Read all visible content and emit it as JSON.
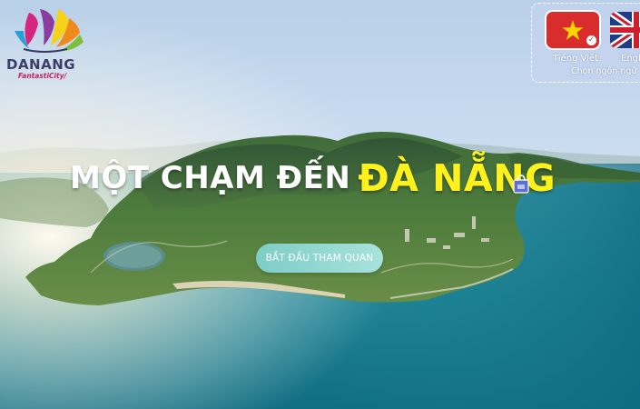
{
  "brand": {
    "name": "DANANG",
    "tagline": "FantastiCity/"
  },
  "languages": {
    "options": [
      {
        "label": "Tiếng Việt",
        "code": "vi",
        "selected": true
      },
      {
        "label": "English",
        "code": "en",
        "selected": false
      }
    ],
    "hint": "Chọn ngôn ngữ"
  },
  "hero": {
    "headline_white": "MỘT CHẠM ĐẾN",
    "headline_yellow": "ĐÀ NẴNG",
    "start_button": "BẮT ĐẦU THAM QUAN"
  },
  "colors": {
    "headline_accent": "#fff21c",
    "button": "#7ecdc7",
    "brand_text": "#3d3d68",
    "tagline": "#c3226b"
  },
  "icons": [
    "vietnam-flag-icon",
    "uk-flag-icon",
    "check-icon",
    "shopping-bag-icon"
  ]
}
